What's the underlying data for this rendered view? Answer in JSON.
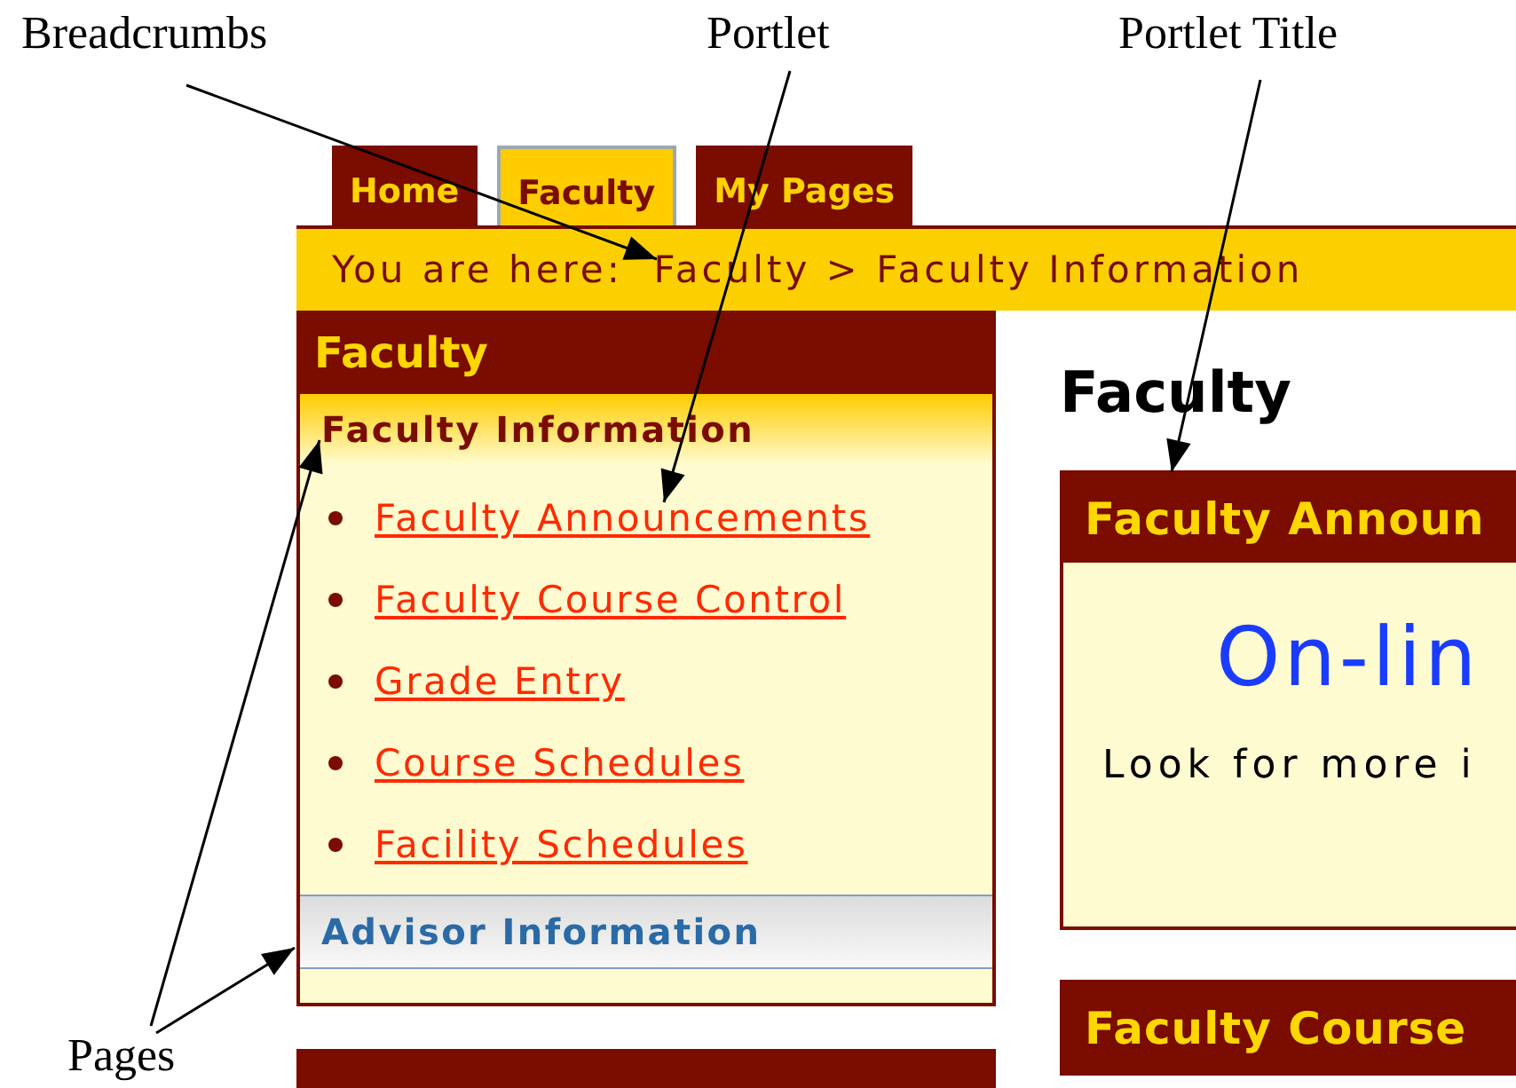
{
  "annotations": [
    {
      "label": "Breadcrumbs"
    },
    {
      "label": "Portlet"
    },
    {
      "label": "Portlet Title"
    },
    {
      "label": "Pages"
    }
  ],
  "tabs": [
    {
      "label": "Home",
      "selected": false
    },
    {
      "label": "Faculty",
      "selected": true
    },
    {
      "label": "My Pages",
      "selected": false
    }
  ],
  "breadcrumb": "You are here:  Faculty > Faculty Information",
  "sidebar": {
    "title": "Faculty",
    "sections": [
      {
        "label": "Faculty Information",
        "expanded": true,
        "pages": [
          "Faculty Announcements",
          "Faculty Course Control",
          "Grade Entry",
          "Course Schedules",
          "Facility Schedules"
        ]
      },
      {
        "label": "Advisor Information",
        "expanded": false
      }
    ]
  },
  "content": {
    "heading": "Faculty",
    "portlets": [
      {
        "title": "Faculty Announ",
        "headline": "On-lin",
        "text": "Look for more i"
      },
      {
        "title": "Faculty Course"
      }
    ]
  }
}
